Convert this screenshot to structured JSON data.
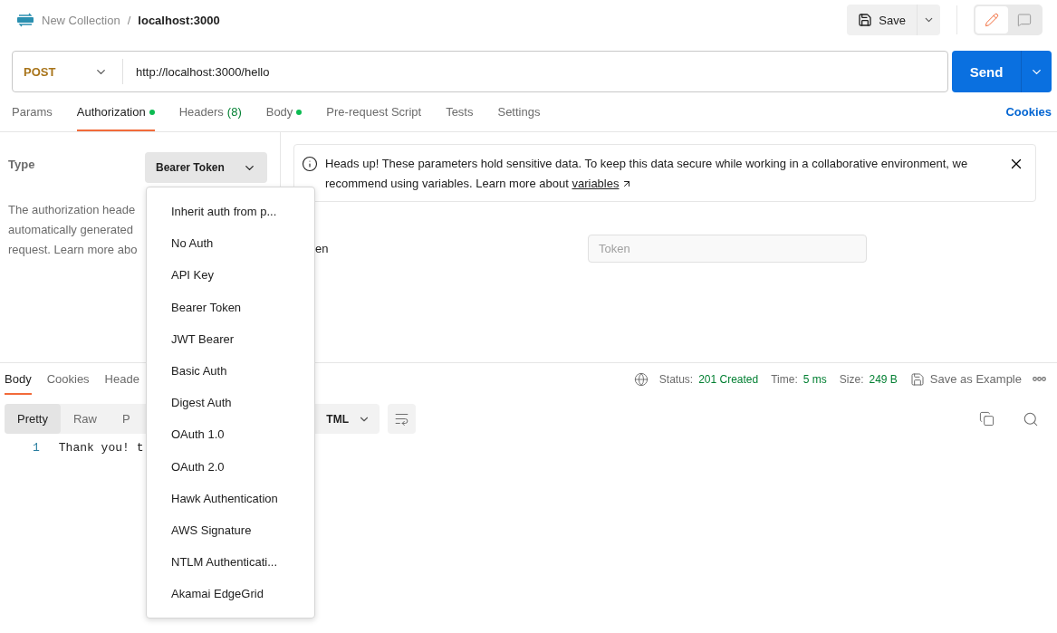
{
  "breadcrumb": {
    "collection": "New Collection",
    "separator": "/",
    "request": "localhost:3000"
  },
  "save": {
    "label": "Save"
  },
  "mode_toggle": [
    {
      "kind": "edit",
      "selected": true
    },
    {
      "kind": "comments",
      "selected": false
    }
  ],
  "request": {
    "method": "POST",
    "url": "http://localhost:3000/hello",
    "send": "Send"
  },
  "request_tabs": [
    {
      "label": "Params",
      "selected": false,
      "dot": false
    },
    {
      "label": "Authorization",
      "selected": true,
      "dot": true
    },
    {
      "label": "Headers",
      "count": "(8)",
      "selected": false,
      "dot": false
    },
    {
      "label": "Body",
      "selected": false,
      "dot": true
    },
    {
      "label": "Pre-request Script",
      "selected": false,
      "dot": false
    },
    {
      "label": "Tests",
      "selected": false,
      "dot": false
    },
    {
      "label": "Settings",
      "selected": false,
      "dot": false
    }
  ],
  "cookies_link": "Cookies",
  "auth": {
    "type_label": "Type",
    "type_value": "Bearer Token",
    "description": [
      "The authorization heade",
      "automatically generated",
      "request. Learn more abo"
    ],
    "banner": {
      "text": "Heads up! These parameters hold sensitive data. To keep this data secure while working in a collaborative environment, we recommend using variables. Learn more about ",
      "link": "variables"
    },
    "token_label": "en",
    "token_placeholder": "Token"
  },
  "auth_options": [
    "Inherit auth from p...",
    "No Auth",
    "API Key",
    "Bearer Token",
    "JWT Bearer",
    "Basic Auth",
    "Digest Auth",
    "OAuth 1.0",
    "OAuth 2.0",
    "Hawk Authentication",
    "AWS Signature",
    "NTLM Authenticati...",
    "Akamai EdgeGrid"
  ],
  "response_tabs": [
    {
      "label": "Body",
      "selected": true
    },
    {
      "label": "Cookies",
      "selected": false
    },
    {
      "label": "Heade",
      "selected": false
    }
  ],
  "status": {
    "status_label": "Status:",
    "status": "201 Created",
    "time_label": "Time:",
    "time": "5 ms",
    "size_label": "Size:",
    "size": "249 B",
    "save_example": "Save as Example"
  },
  "view_modes": [
    {
      "label": "Pretty",
      "selected": true
    },
    {
      "label": "Raw",
      "selected": false
    },
    {
      "label": "P",
      "selected": false
    }
  ],
  "language": "TML",
  "code_lines": [
    {
      "number": "1",
      "text": "Thank you! t"
    }
  ]
}
